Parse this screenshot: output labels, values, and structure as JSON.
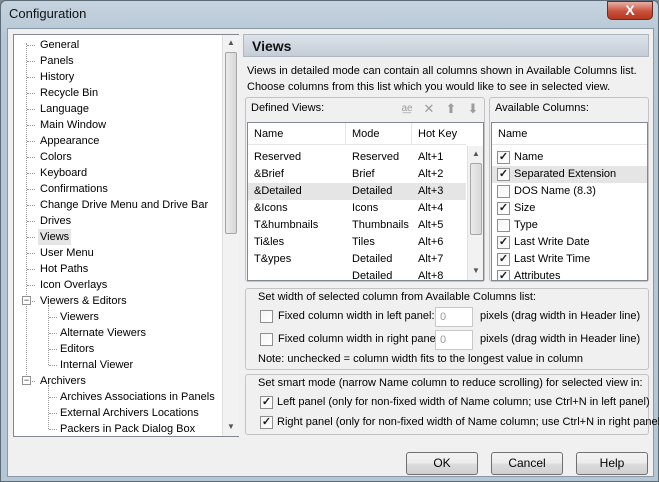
{
  "window": {
    "title": "Configuration",
    "close_glyph": "X"
  },
  "tree": {
    "items": [
      {
        "label": "General"
      },
      {
        "label": "Panels"
      },
      {
        "label": "History"
      },
      {
        "label": "Recycle Bin"
      },
      {
        "label": "Language"
      },
      {
        "label": "Main Window"
      },
      {
        "label": "Appearance"
      },
      {
        "label": "Colors"
      },
      {
        "label": "Keyboard"
      },
      {
        "label": "Confirmations"
      },
      {
        "label": "Change Drive Menu and Drive Bar"
      },
      {
        "label": "Drives"
      },
      {
        "label": "Views",
        "selected": true
      },
      {
        "label": "User Menu"
      },
      {
        "label": "Hot Paths"
      },
      {
        "label": "Icon Overlays"
      },
      {
        "label": "Viewers & Editors",
        "expanded": true
      },
      {
        "label": "Viewers"
      },
      {
        "label": "Alternate Viewers"
      },
      {
        "label": "Editors"
      },
      {
        "label": "Internal Viewer"
      },
      {
        "label": "Archivers",
        "expanded": true
      },
      {
        "label": "Archives Associations in Panels"
      },
      {
        "label": "External Archivers Locations"
      },
      {
        "label": "Packers in Pack Dialog Box"
      }
    ],
    "expander_glyph": "−"
  },
  "header": {
    "title": "Views"
  },
  "description": "Views in detailed mode can contain all columns shown in Available Columns list. Choose columns from this list which you would like to see in selected view.",
  "defined_views": {
    "label": "Defined Views:",
    "toolbar": {
      "rename_glyph": "a͟e",
      "delete_glyph": "✕",
      "up_glyph": "⬆",
      "down_glyph": "⬇"
    },
    "columns": [
      "Name",
      "Mode",
      "Hot Key"
    ],
    "rows": [
      {
        "name": "Reserved",
        "mode": "Reserved",
        "hotkey": "Alt+1"
      },
      {
        "name": "&Brief",
        "mode": "Brief",
        "hotkey": "Alt+2"
      },
      {
        "name": "&Detailed",
        "mode": "Detailed",
        "hotkey": "Alt+3",
        "selected": true
      },
      {
        "name": "&Icons",
        "mode": "Icons",
        "hotkey": "Alt+4"
      },
      {
        "name": "T&humbnails",
        "mode": "Thumbnails",
        "hotkey": "Alt+5"
      },
      {
        "name": "Ti&les",
        "mode": "Tiles",
        "hotkey": "Alt+6"
      },
      {
        "name": "T&ypes",
        "mode": "Detailed",
        "hotkey": "Alt+7"
      },
      {
        "name": "",
        "mode": "Detailed",
        "hotkey": "Alt+8"
      }
    ]
  },
  "available_columns": {
    "label": "Available Columns:",
    "column_header": "Name",
    "items": [
      {
        "label": "Name",
        "checked": true
      },
      {
        "label": "Separated Extension",
        "checked": true,
        "selected": true
      },
      {
        "label": "DOS Name (8.3)",
        "checked": false
      },
      {
        "label": "Size",
        "checked": true
      },
      {
        "label": "Type",
        "checked": false
      },
      {
        "label": "Last Write Date",
        "checked": true
      },
      {
        "label": "Last Write Time",
        "checked": true
      },
      {
        "label": "Attributes",
        "checked": true
      }
    ]
  },
  "width_group": {
    "title": "Set width of selected column from Available Columns list:",
    "left": {
      "label": "Fixed column width in left panel:",
      "checked": false,
      "value": "0",
      "unit": "pixels (drag width in Header line)"
    },
    "right": {
      "label": "Fixed column width in right panel:",
      "checked": false,
      "value": "0",
      "unit": "pixels (drag width in Header line)"
    },
    "note": "Note: unchecked = column width fits to the longest value in column"
  },
  "smart_group": {
    "title": "Set smart mode (narrow Name column to reduce scrolling) for selected view in:",
    "left": {
      "label": "Left panel (only for non-fixed width of Name column; use Ctrl+N in left panel)",
      "checked": true
    },
    "right": {
      "label": "Right panel (only for non-fixed width of Name column; use Ctrl+N in right panel)",
      "checked": true
    }
  },
  "buttons": {
    "ok": "OK",
    "cancel": "Cancel",
    "help": "Help"
  },
  "check_glyph": "✓",
  "scroll": {
    "up": "▲",
    "down": "▼"
  }
}
